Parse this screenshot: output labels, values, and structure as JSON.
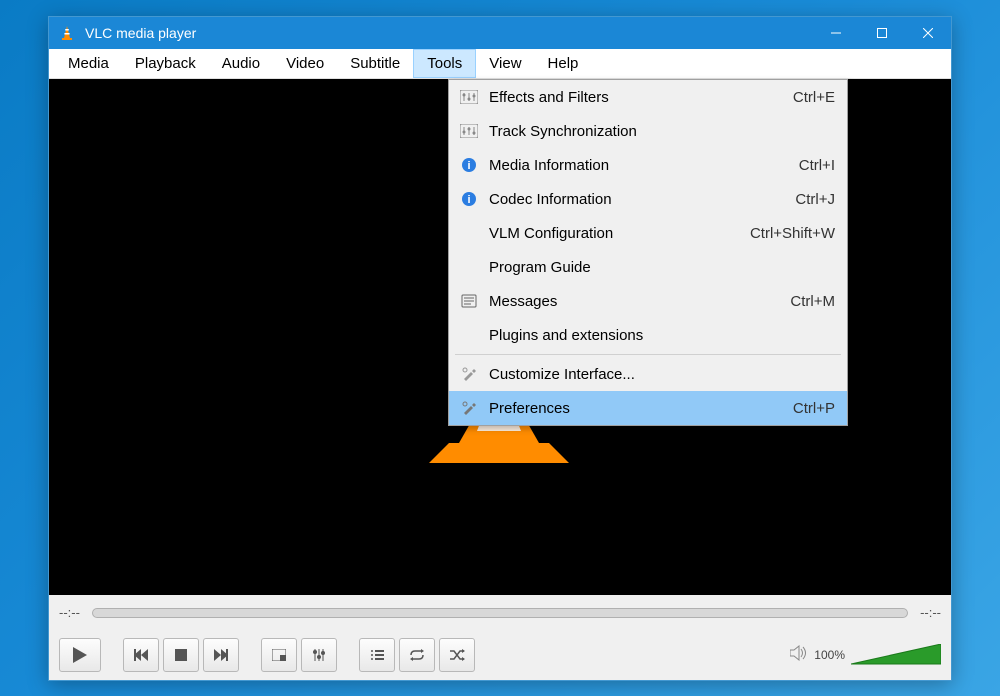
{
  "window": {
    "title": "VLC media player"
  },
  "menubar": {
    "items": [
      {
        "label": "Media"
      },
      {
        "label": "Playback"
      },
      {
        "label": "Audio"
      },
      {
        "label": "Video"
      },
      {
        "label": "Subtitle"
      },
      {
        "label": "Tools",
        "active": true
      },
      {
        "label": "View"
      },
      {
        "label": "Help"
      }
    ]
  },
  "dropdown": {
    "items": [
      {
        "icon": "equalizer-icon",
        "label": "Effects and Filters",
        "shortcut": "Ctrl+E"
      },
      {
        "icon": "equalizer-icon",
        "label": "Track Synchronization",
        "shortcut": ""
      },
      {
        "icon": "info-icon",
        "label": "Media Information",
        "shortcut": "Ctrl+I"
      },
      {
        "icon": "info-icon",
        "label": "Codec Information",
        "shortcut": "Ctrl+J"
      },
      {
        "icon": "",
        "label": "VLM Configuration",
        "shortcut": "Ctrl+Shift+W"
      },
      {
        "icon": "",
        "label": "Program Guide",
        "shortcut": ""
      },
      {
        "icon": "messages-icon",
        "label": "Messages",
        "shortcut": "Ctrl+M"
      },
      {
        "icon": "",
        "label": "Plugins and extensions",
        "shortcut": ""
      },
      {
        "sep": true
      },
      {
        "icon": "tools-icon",
        "label": "Customize Interface...",
        "shortcut": ""
      },
      {
        "icon": "tools-icon",
        "label": "Preferences",
        "shortcut": "Ctrl+P",
        "highlighted": true
      }
    ]
  },
  "seek": {
    "left": "--:--",
    "right": "--:--"
  },
  "volume": {
    "percent": "100%"
  }
}
